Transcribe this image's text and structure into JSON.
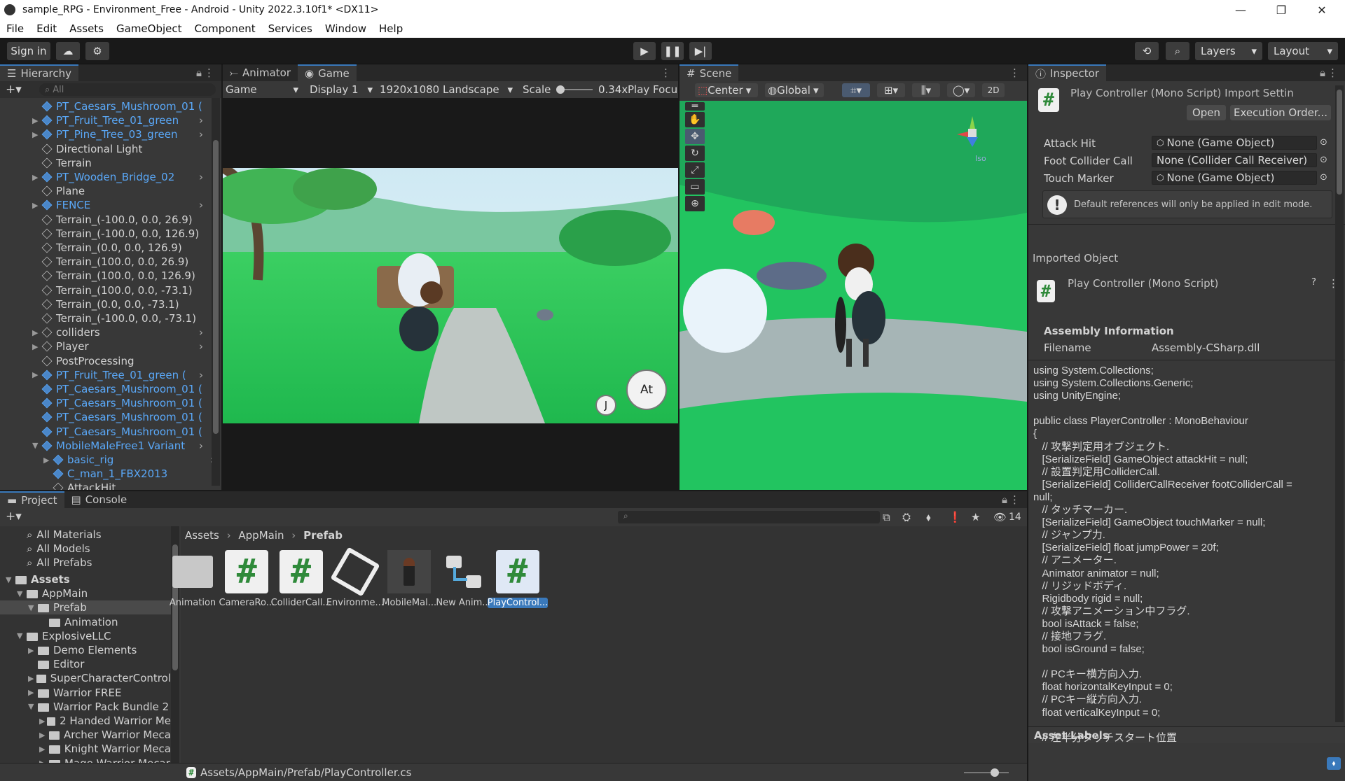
{
  "window": {
    "title": "sample_RPG - Environment_Free - Android - Unity 2022.3.10f1* <DX11>",
    "minimize": "—",
    "maximize": "❐",
    "close": "✕"
  },
  "menu": [
    "File",
    "Edit",
    "Assets",
    "GameObject",
    "Component",
    "Services",
    "Window",
    "Help"
  ],
  "toolbar": {
    "sign_in": "Sign in",
    "layers": "Layers",
    "layout": "Layout"
  },
  "hierarchy": {
    "tab": "Hierarchy",
    "search_placeholder": "All",
    "items": [
      {
        "label": "PT_Caesars_Mushroom_01 (",
        "blue": true,
        "arrow": "",
        "indent": 0
      },
      {
        "label": "PT_Fruit_Tree_01_green",
        "blue": true,
        "arrow": "▶",
        "indent": 0
      },
      {
        "label": "PT_Pine_Tree_03_green",
        "blue": true,
        "arrow": "▶",
        "indent": 0
      },
      {
        "label": "Directional Light",
        "blue": false,
        "arrow": "",
        "indent": 0
      },
      {
        "label": "Terrain",
        "blue": false,
        "arrow": "",
        "indent": 0
      },
      {
        "label": "PT_Wooden_Bridge_02",
        "blue": true,
        "arrow": "▶",
        "indent": 0
      },
      {
        "label": "Plane",
        "blue": false,
        "arrow": "",
        "indent": 0
      },
      {
        "label": "FENCE",
        "blue": true,
        "arrow": "▶",
        "indent": 0
      },
      {
        "label": "Terrain_(-100.0, 0.0, 26.9)",
        "blue": false,
        "arrow": "",
        "indent": 0
      },
      {
        "label": "Terrain_(-100.0, 0.0, 126.9)",
        "blue": false,
        "arrow": "",
        "indent": 0
      },
      {
        "label": "Terrain_(0.0, 0.0, 126.9)",
        "blue": false,
        "arrow": "",
        "indent": 0
      },
      {
        "label": "Terrain_(100.0, 0.0, 26.9)",
        "blue": false,
        "arrow": "",
        "indent": 0
      },
      {
        "label": "Terrain_(100.0, 0.0, 126.9)",
        "blue": false,
        "arrow": "",
        "indent": 0
      },
      {
        "label": "Terrain_(100.0, 0.0, -73.1)",
        "blue": false,
        "arrow": "",
        "indent": 0
      },
      {
        "label": "Terrain_(0.0, 0.0, -73.1)",
        "blue": false,
        "arrow": "",
        "indent": 0
      },
      {
        "label": "Terrain_(-100.0, 0.0, -73.1)",
        "blue": false,
        "arrow": "",
        "indent": 0
      },
      {
        "label": "colliders",
        "blue": false,
        "arrow": "▶",
        "indent": 0
      },
      {
        "label": "Player",
        "blue": false,
        "arrow": "▶",
        "indent": 0
      },
      {
        "label": "PostProcessing",
        "blue": false,
        "arrow": "",
        "indent": 0
      },
      {
        "label": "PT_Fruit_Tree_01_green (",
        "blue": true,
        "arrow": "▶",
        "indent": 0
      },
      {
        "label": "PT_Caesars_Mushroom_01 (",
        "blue": true,
        "arrow": "",
        "indent": 0
      },
      {
        "label": "PT_Caesars_Mushroom_01 (",
        "blue": true,
        "arrow": "",
        "indent": 0
      },
      {
        "label": "PT_Caesars_Mushroom_01 (",
        "blue": true,
        "arrow": "",
        "indent": 0
      },
      {
        "label": "PT_Caesars_Mushroom_01 (",
        "blue": true,
        "arrow": "",
        "indent": 0
      },
      {
        "label": "MobileMaleFree1 Variant",
        "blue": true,
        "arrow": "▼",
        "indent": 0
      },
      {
        "label": "basic_rig",
        "blue": true,
        "arrow": "▶",
        "indent": 1
      },
      {
        "label": "C_man_1_FBX2013",
        "blue": true,
        "arrow": "",
        "indent": 1
      },
      {
        "label": "AttackHit",
        "blue": false,
        "arrow": "",
        "indent": 1
      }
    ]
  },
  "game": {
    "tab_animator": "Animator",
    "tab_game": "Game",
    "mode": "Game",
    "display": "Display 1",
    "resolution": "1920x1080 Landscape",
    "scale_label": "Scale",
    "scale_value": "0.34x",
    "play_focus": "Play Focu",
    "btn_attack": "At",
    "btn_jump": "J"
  },
  "scene": {
    "tab": "Scene",
    "pivot": "Center",
    "space": "Global",
    "mode2d": "2D",
    "gizmo_label": "Iso"
  },
  "inspector": {
    "tab": "Inspector",
    "header_title": "Play Controller (Mono Script) Import Settin",
    "open": "Open",
    "execution_order": "Execution Order...",
    "fields": [
      {
        "label": "Attack Hit",
        "value": "None (Game Object)"
      },
      {
        "label": "Foot Collider Call",
        "value": "None (Collider Call Receiver)"
      },
      {
        "label": "Touch Marker",
        "value": "None (Game Object)"
      }
    ],
    "info": "Default references will only be applied in edit mode.",
    "imported_object": "Imported Object",
    "imported_title": "Play Controller (Mono Script)",
    "assembly_info": "Assembly Information",
    "filename_label": "Filename",
    "filename_value": "Assembly-CSharp.dll",
    "asset_labels": "Asset Labels",
    "code": "using System.Collections;\nusing System.Collections.Generic;\nusing UnityEngine;\n\npublic class PlayerController : MonoBehaviour\n{\n   // 攻撃判定用オブジェクト.\n   [SerializeField] GameObject attackHit = null;\n   // 設置判定用ColliderCall.\n   [SerializeField] ColliderCallReceiver footColliderCall =\nnull;\n   // タッチマーカー.\n   [SerializeField] GameObject touchMarker = null;\n   // ジャンプ力.\n   [SerializeField] float jumpPower = 20f;\n   // アニメーター.\n   Animator animator = null;\n   // リジッドボディ.\n   Rigidbody rigid = null;\n   // 攻撃アニメーション中フラグ.\n   bool isAttack = false;\n   // 接地フラグ.\n   bool isGround = false;\n\n   // PCキー横方向入力.\n   float horizontalKeyInput = 0;\n   // PCキー縦方向入力.\n   float verticalKeyInput = 0;\n\n   // 左半分タッチスタート位置"
  },
  "project": {
    "tab_project": "Project",
    "tab_console": "Console",
    "hidden_count": "14",
    "favorites": [
      "All Materials",
      "All Models",
      "All Prefabs"
    ],
    "tree": [
      {
        "label": "Assets",
        "arrow": "▼",
        "depth": 0,
        "bold": true
      },
      {
        "label": "AppMain",
        "arrow": "▼",
        "depth": 1
      },
      {
        "label": "Prefab",
        "arrow": "▼",
        "depth": 2,
        "selected": true
      },
      {
        "label": "Animation",
        "arrow": "",
        "depth": 3
      },
      {
        "label": "ExplosiveLLC",
        "arrow": "▼",
        "depth": 1
      },
      {
        "label": "Demo Elements",
        "arrow": "▶",
        "depth": 2
      },
      {
        "label": "Editor",
        "arrow": "",
        "depth": 2
      },
      {
        "label": "SuperCharacterControl",
        "arrow": "▶",
        "depth": 2
      },
      {
        "label": "Warrior FREE",
        "arrow": "▶",
        "depth": 2
      },
      {
        "label": "Warrior Pack Bundle 2",
        "arrow": "▼",
        "depth": 2
      },
      {
        "label": "2 Handed Warrior Me",
        "arrow": "▶",
        "depth": 3
      },
      {
        "label": "Archer Warrior Meca",
        "arrow": "▶",
        "depth": 3
      },
      {
        "label": "Knight Warrior Meca",
        "arrow": "▶",
        "depth": 3
      },
      {
        "label": "Mage Warrior Mecar",
        "arrow": "▶",
        "depth": 3
      }
    ],
    "breadcrumb": [
      "Assets",
      "AppMain",
      "Prefab"
    ],
    "assets": [
      "Animation",
      "CameraRo...",
      "ColliderCall...",
      "Environme...",
      "MobileMal...",
      "New Anim...",
      "PlayControl..."
    ],
    "status_path": "Assets/AppMain/Prefab/PlayController.cs"
  },
  "colors": {
    "accent": "#3a79bb",
    "panel": "#383838",
    "dark": "#282828",
    "link": "#5aa8f8",
    "grass": "#2fd46a",
    "hash": "#2f8a3a"
  }
}
